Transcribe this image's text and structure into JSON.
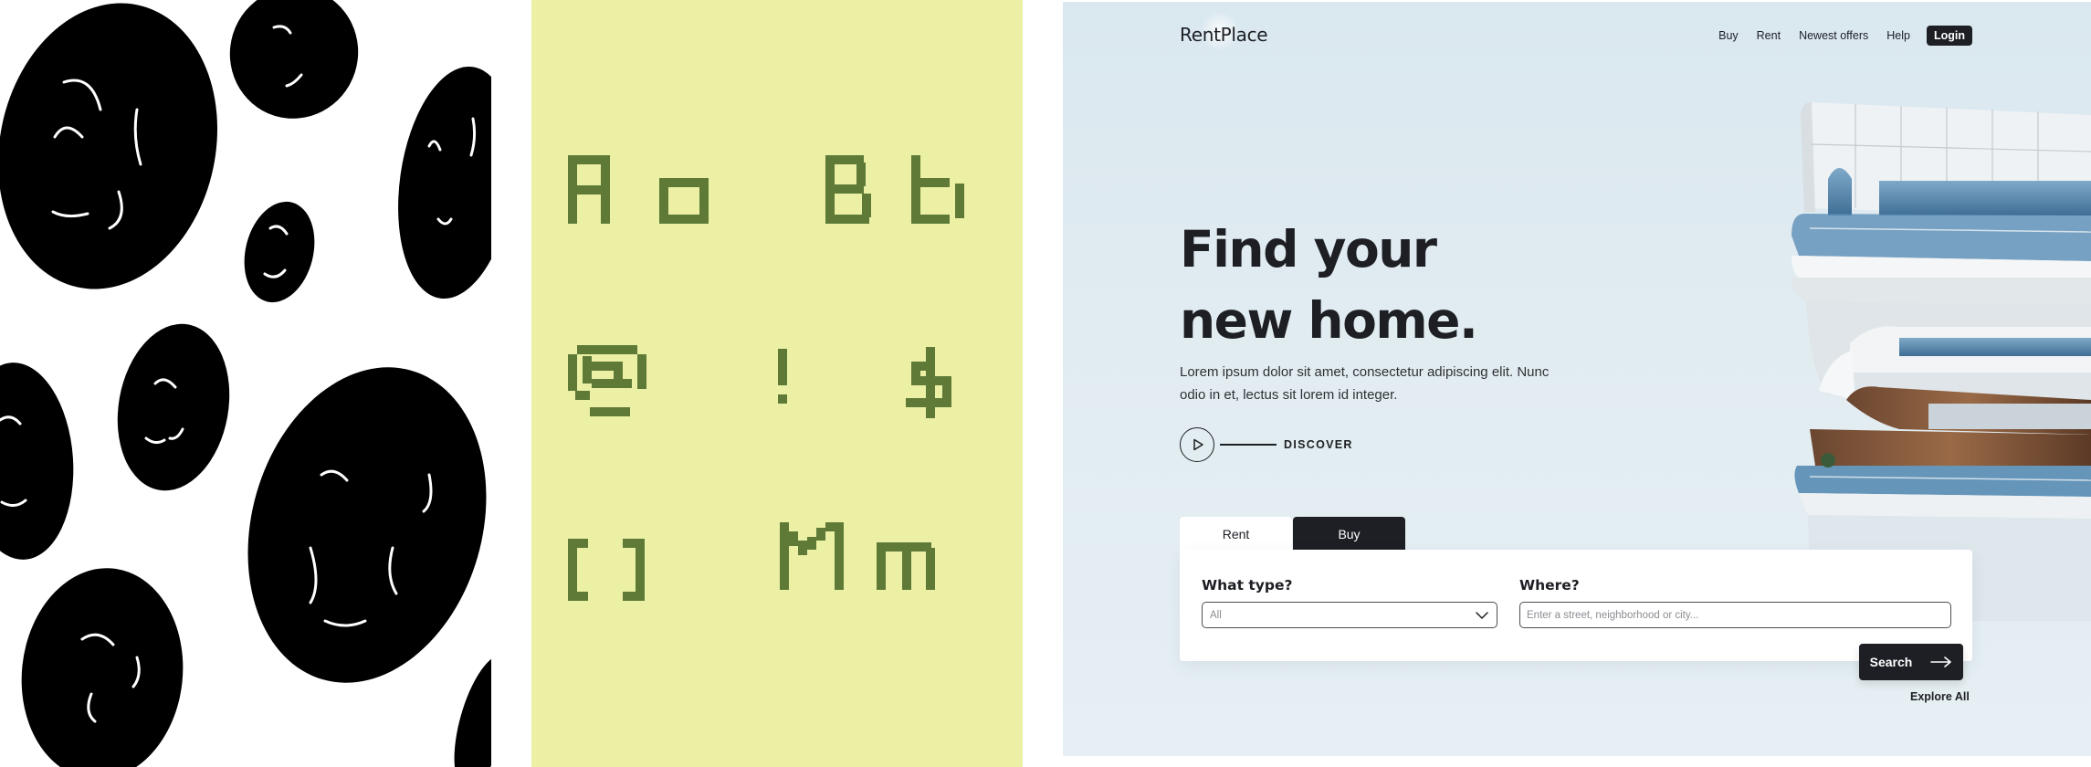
{
  "site": {
    "logo": "RentPlace",
    "nav": [
      "Buy",
      "Rent",
      "Newest offers",
      "Help"
    ],
    "login_label": "Login"
  },
  "hero": {
    "title_line1": "Find your",
    "title_line2": "new home.",
    "description": "Lorem ipsum dolor sit amet, consectetur adipiscing elit. Nunc odio in et, lectus sit lorem id integer.",
    "discover_label": "DISCOVER"
  },
  "search": {
    "tabs": [
      "Rent",
      "Buy"
    ],
    "active_tab": "Rent",
    "type_label": "What type?",
    "type_value": "All",
    "where_label": "Where?",
    "where_placeholder": "Enter a street, neighborhood or city...",
    "search_label": "Search",
    "explore_label": "Explore All"
  },
  "font_specimen": {
    "glyphs": [
      "A",
      "a",
      "B",
      "b",
      "@",
      "!",
      "$",
      "[",
      "]",
      "M",
      "m"
    ]
  },
  "colors": {
    "ink": "#1d1f24",
    "hero_bg": "#dce9f0",
    "specimen_bg": "#ebf0a5",
    "specimen_glyph": "#5f7a36",
    "blob": "#000000"
  }
}
